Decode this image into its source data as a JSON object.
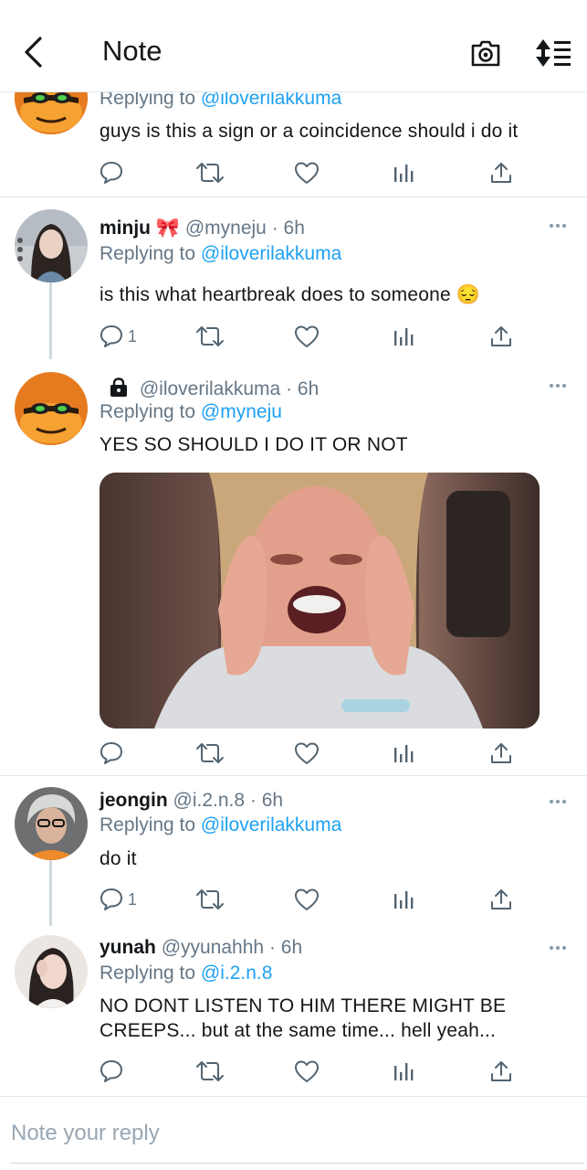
{
  "header": {
    "title": "Note",
    "back_icon": "chevron-left-icon",
    "camera_icon": "camera-icon",
    "sort_icon": "sort-icon"
  },
  "colors": {
    "accent": "#1da1f2",
    "text": "#14171a",
    "muted": "#657786",
    "divider": "#e1e8ed"
  },
  "tweets": [
    {
      "replying_label": "Replying to",
      "mention": "@iloverilakkuma",
      "text": "guys is this a sign or a coincidence should i do it",
      "reply_count": ""
    },
    {
      "name": "minju",
      "emoji": "🎀",
      "handle": "@myneju",
      "time": "6h",
      "replying_label": "Replying to",
      "mention": "@iloverilakkuma",
      "text": "is this what heartbreak does to someone 😔",
      "reply_count": "1"
    },
    {
      "handle": "@iloverilakkuma",
      "time": "6h",
      "replying_label": "Replying to",
      "mention": "@myneju",
      "text": "YES SO SHOULD I DO IT OR NOT",
      "reply_count": "",
      "lock_icon": "lock-icon"
    },
    {
      "name": "jeongin",
      "handle": "@i.2.n.8",
      "time": "6h",
      "replying_label": "Replying to",
      "mention": "@iloverilakkuma",
      "text": "do it",
      "reply_count": "1"
    },
    {
      "name": "yunah",
      "handle": "@yyunahhh",
      "time": "6h",
      "replying_label": "Replying to",
      "mention": "@i.2.n.8",
      "text_line1": "NO DONT LISTEN TO HIM THERE MIGHT BE",
      "text_line2": "CREEPS... but at the same time... hell yeah...",
      "reply_count": ""
    }
  ],
  "sep": "·",
  "reply_box": {
    "placeholder": "Note your reply"
  }
}
